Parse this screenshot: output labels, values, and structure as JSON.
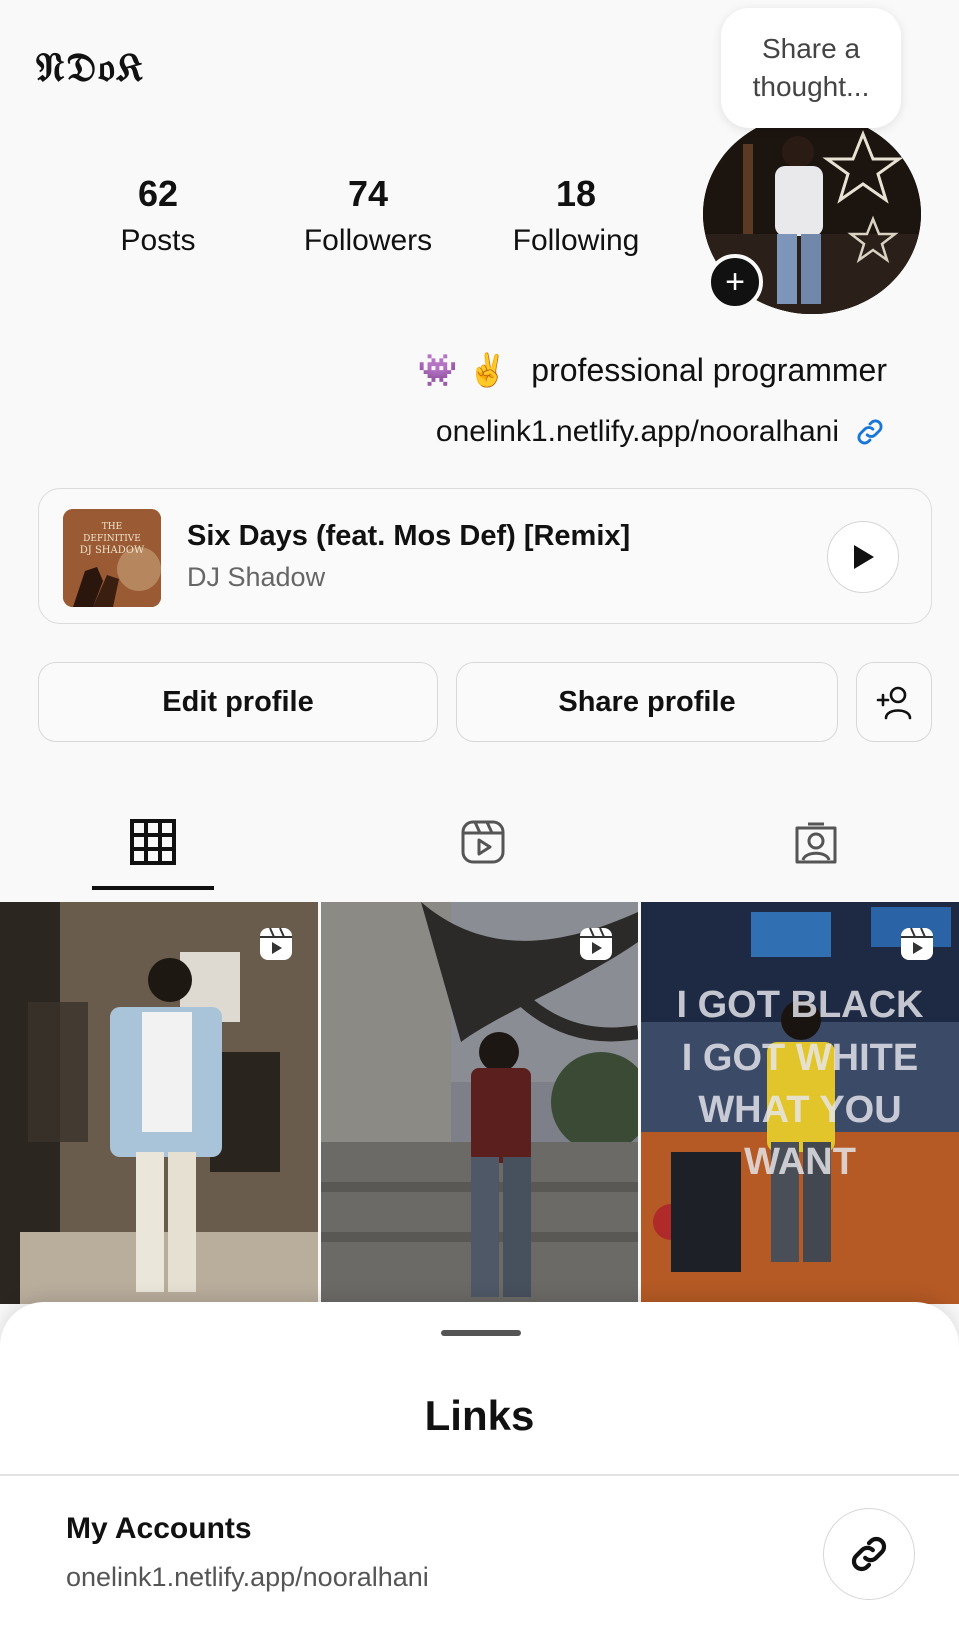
{
  "header": {
    "logo_text": "𝔑𝔇𝔬𝔎",
    "thought_placeholder": "Share a thought..."
  },
  "stats": {
    "posts": {
      "value": "62",
      "label": "Posts"
    },
    "followers": {
      "value": "74",
      "label": "Followers"
    },
    "following": {
      "value": "18",
      "label": "Following"
    }
  },
  "bio": {
    "emojis": "👾 ✌️",
    "text": "professional programmer",
    "link": "onelink1.netlify.app/nooralhani"
  },
  "music": {
    "title": "Six Days (feat. Mos Def) [Remix]",
    "artist": "DJ Shadow",
    "album_text_line1": "THE",
    "album_text_line2": "DEFINITIVE",
    "album_text_line3": "DJ SHADOW"
  },
  "actions": {
    "edit_label": "Edit profile",
    "share_label": "Share profile"
  },
  "tabs": [
    {
      "name": "posts-grid",
      "icon": "grid-icon",
      "active": true
    },
    {
      "name": "reels",
      "icon": "reels-icon",
      "active": false
    },
    {
      "name": "tagged",
      "icon": "tagged-icon",
      "active": false
    }
  ],
  "grid": {
    "tile3_overlay": [
      "I GOT BLACK",
      "I GOT WHITE",
      "WHAT YOU",
      "WANT"
    ]
  },
  "sheet": {
    "title": "Links",
    "account_title": "My Accounts",
    "account_url": "onelink1.netlify.app/nooralhani"
  },
  "colors": {
    "accent_link": "#1877d6",
    "text": "#111111",
    "muted": "#666666"
  }
}
